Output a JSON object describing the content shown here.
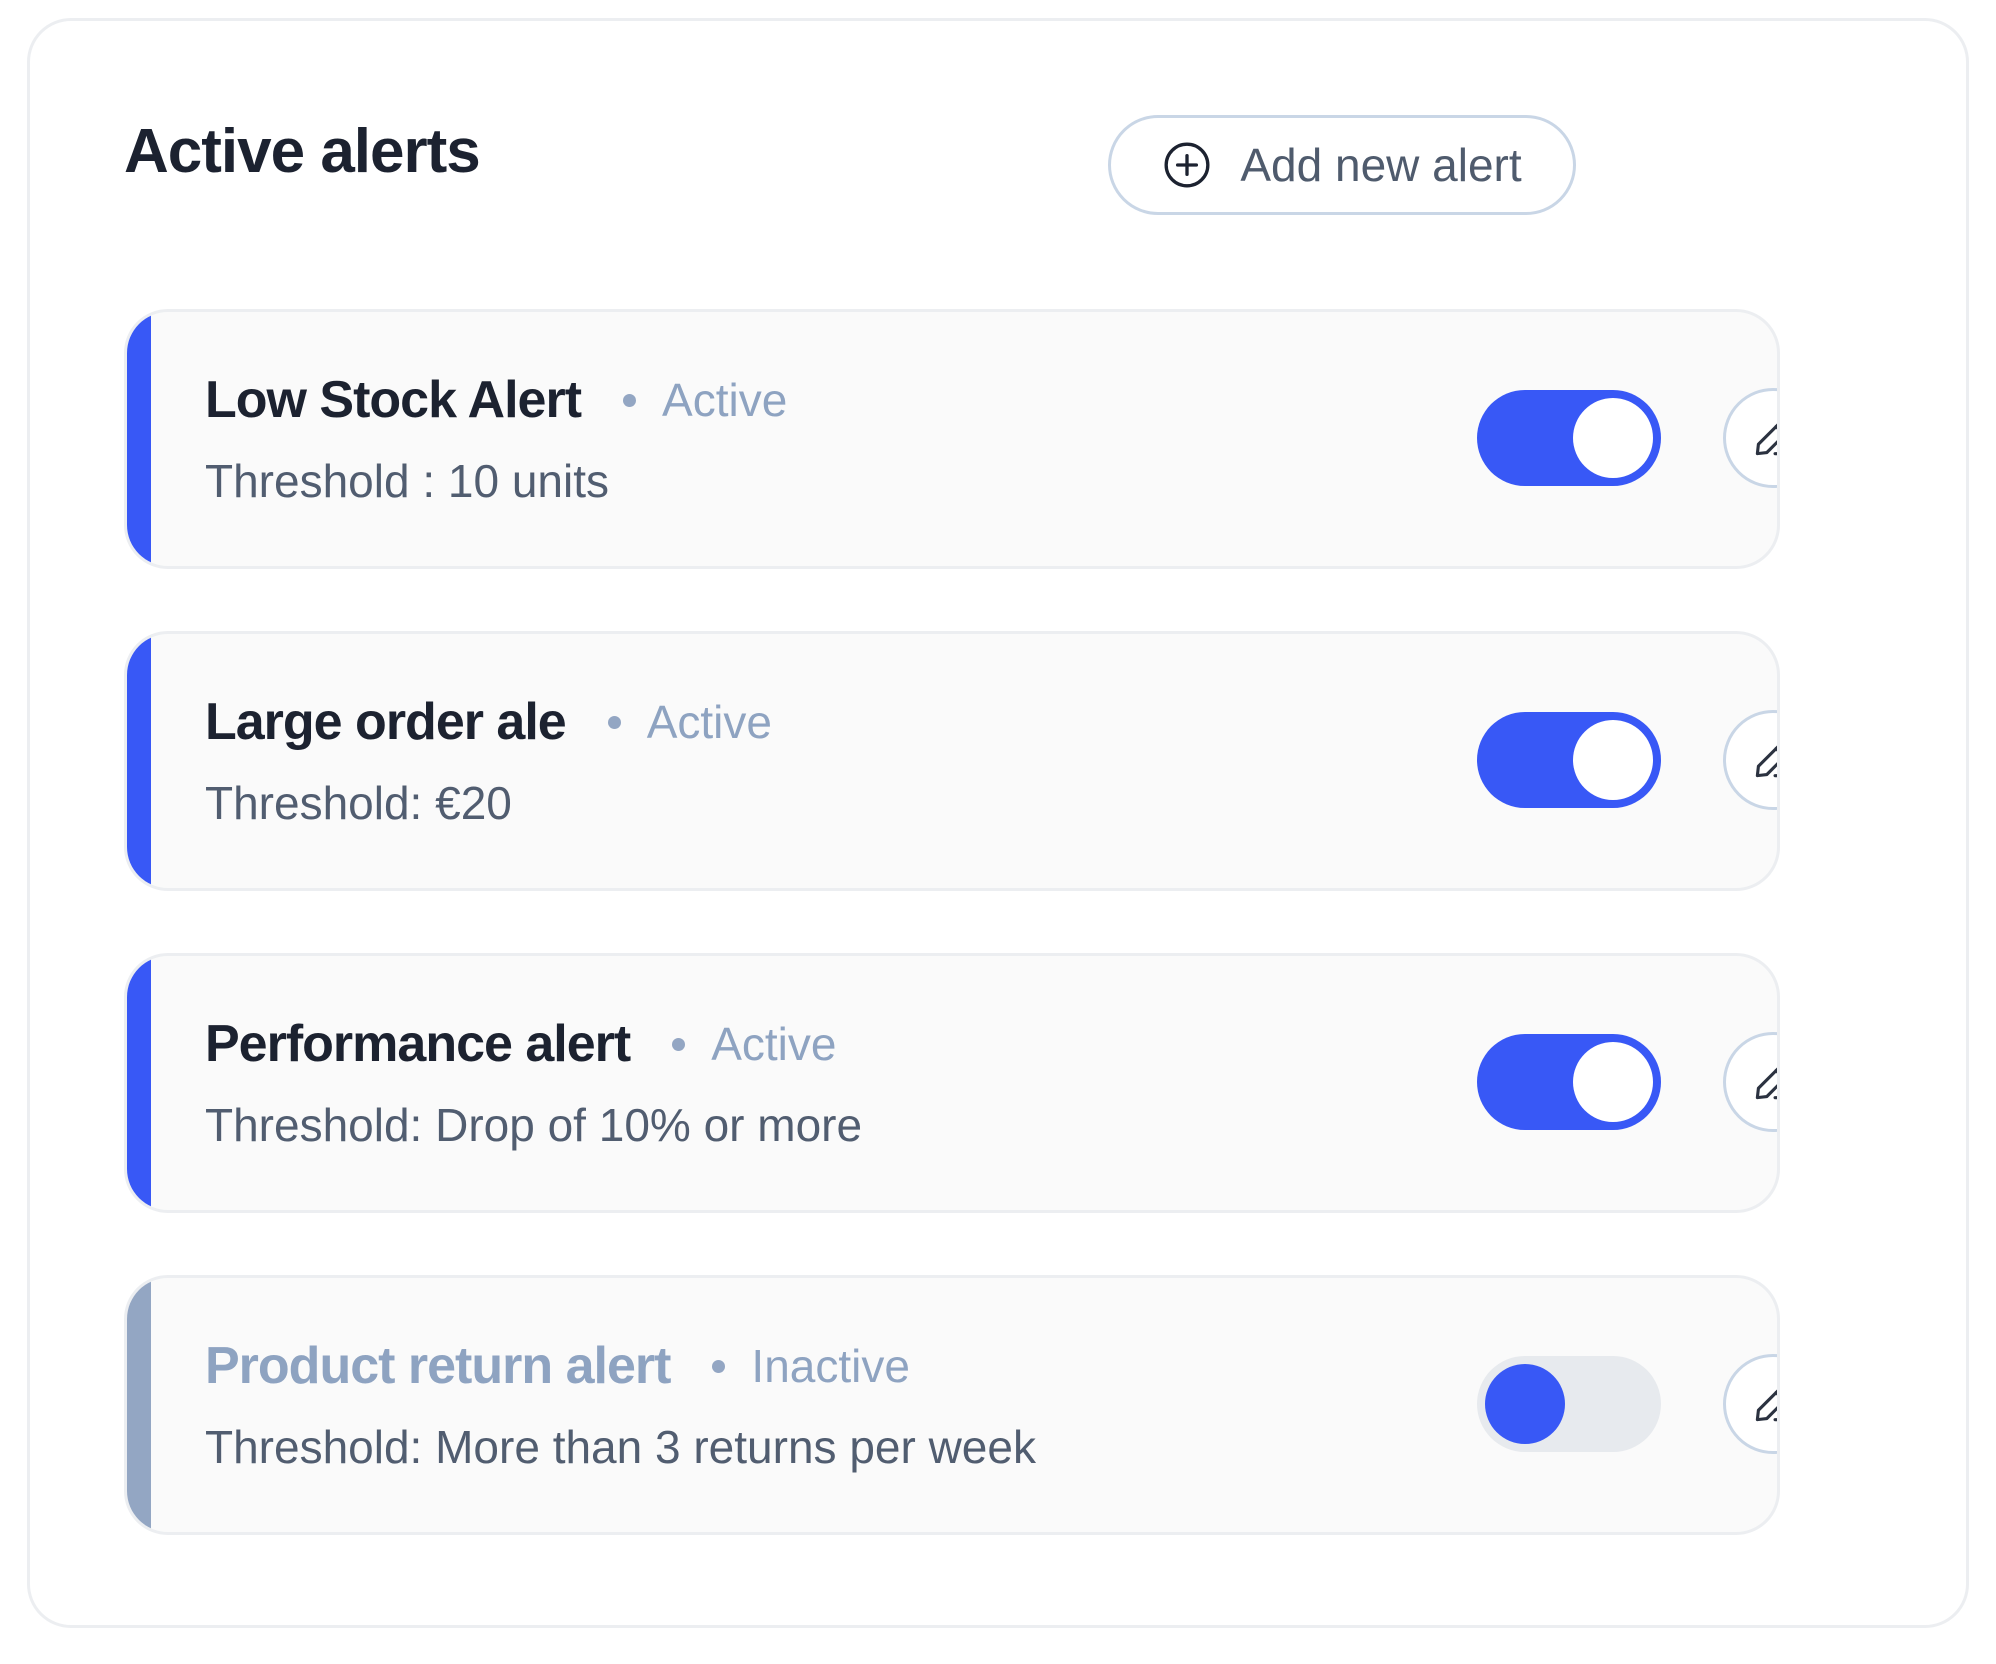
{
  "header": {
    "title": "Active alerts",
    "add_button": {
      "label": "Add new alert",
      "icon": "plus-circle-icon"
    }
  },
  "alerts": [
    {
      "name": "Low Stock Alert",
      "status": "Active",
      "threshold": "Threshold : 10 units",
      "enabled": true,
      "edit_icon": "pencil-icon"
    },
    {
      "name": "Large order ale",
      "status": "Active",
      "threshold": "Threshold: €20",
      "enabled": true,
      "edit_icon": "pencil-icon"
    },
    {
      "name": "Performance alert",
      "status": "Active",
      "threshold": "Threshold: Drop of 10% or more",
      "enabled": true,
      "edit_icon": "pencil-icon"
    },
    {
      "name": "Product return alert",
      "status": "Inactive",
      "threshold": "Threshold: More than 3 returns per week",
      "enabled": false,
      "edit_icon": "pencil-icon"
    }
  ],
  "colors": {
    "accent_active": "#3858f6",
    "accent_inactive": "#93a6c3",
    "title_text": "#1c2230",
    "muted_text": "#8ea3c1",
    "body_text": "#515d70",
    "toggle_off_track": "#e7eaee"
  }
}
